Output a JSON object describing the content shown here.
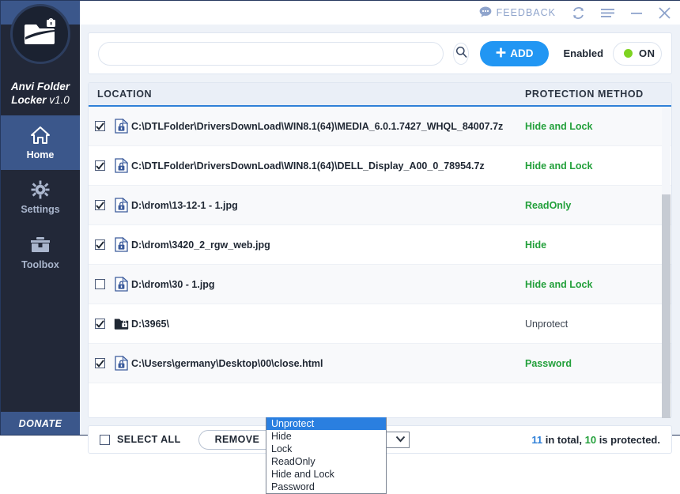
{
  "app": {
    "brand_line1": "Anvi Folder",
    "brand_line2": "Locker",
    "brand_version": "v1.0",
    "donate_label": "DONATE",
    "accent_blue": "#2196f3",
    "sidebar_dark": "#222838",
    "sidebar_active": "#3b578b",
    "green": "#23a03b"
  },
  "titlebar": {
    "feedback_label": "FEEDBACK",
    "feedback_icon": "chat-bubble-icon",
    "update_icon": "refresh-icon",
    "menu_icon": "hamburger-menu-icon",
    "minimize_icon": "minimize-icon",
    "close_icon": "close-icon"
  },
  "sidebar": {
    "items": [
      {
        "label": "Home",
        "icon": "home-icon",
        "active": true
      },
      {
        "label": "Settings",
        "icon": "gear-icon",
        "active": false
      },
      {
        "label": "Toolbox",
        "icon": "toolbox-icon",
        "active": false
      }
    ]
  },
  "toolbar": {
    "search_value": "",
    "search_placeholder": "",
    "search_icon": "search-icon",
    "add_label": "ADD",
    "add_icon": "plus-icon",
    "enabled_label": "Enabled",
    "toggle_state": "ON"
  },
  "table": {
    "headers": {
      "location": "LOCATION",
      "method": "PROTECTION METHOD"
    },
    "rows": [
      {
        "checked": true,
        "icon": "file-lock-icon",
        "location": "C:\\DTLFolder\\DriversDownLoad\\WIN8.1(64)\\MEDIA_6.0.1.7427_WHQL_84007.7z",
        "method": "Hide and Lock",
        "method_style": "green"
      },
      {
        "checked": true,
        "icon": "file-lock-icon",
        "location": "C:\\DTLFolder\\DriversDownLoad\\WIN8.1(64)\\DELL_Display_A00_0_78954.7z",
        "method": "Hide and Lock",
        "method_style": "green"
      },
      {
        "checked": true,
        "icon": "file-lock-icon",
        "location": "D:\\drom\\13-12-1 - 1.jpg",
        "method": "ReadOnly",
        "method_style": "green"
      },
      {
        "checked": true,
        "icon": "file-lock-icon",
        "location": "D:\\drom\\3420_2_rgw_web.jpg",
        "method": "Hide",
        "method_style": "green"
      },
      {
        "checked": false,
        "icon": "file-lock-icon",
        "location": "D:\\drom\\30 - 1.jpg",
        "method": "Hide and Lock",
        "method_style": "green"
      },
      {
        "checked": true,
        "icon": "folder-lock-icon",
        "location": "D:\\3965\\",
        "method": "Unprotect",
        "method_style": "gray"
      },
      {
        "checked": true,
        "icon": "file-lock-icon",
        "location": "C:\\Users\\germany\\Desktop\\00\\close.html",
        "method": "Password",
        "method_style": "green"
      }
    ]
  },
  "footer": {
    "select_all_label": "SELECT ALL",
    "select_all_checked": false,
    "remove_label": "REMOVE",
    "method_selected": "Unprotect",
    "method_options": [
      "Unprotect",
      "Hide",
      "Lock",
      "ReadOnly",
      "Hide and Lock",
      "Password"
    ],
    "dropdown_open": true,
    "totals_count": "11",
    "totals_mid": " in total, ",
    "totals_protected": "10",
    "totals_suffix": " is protected."
  }
}
